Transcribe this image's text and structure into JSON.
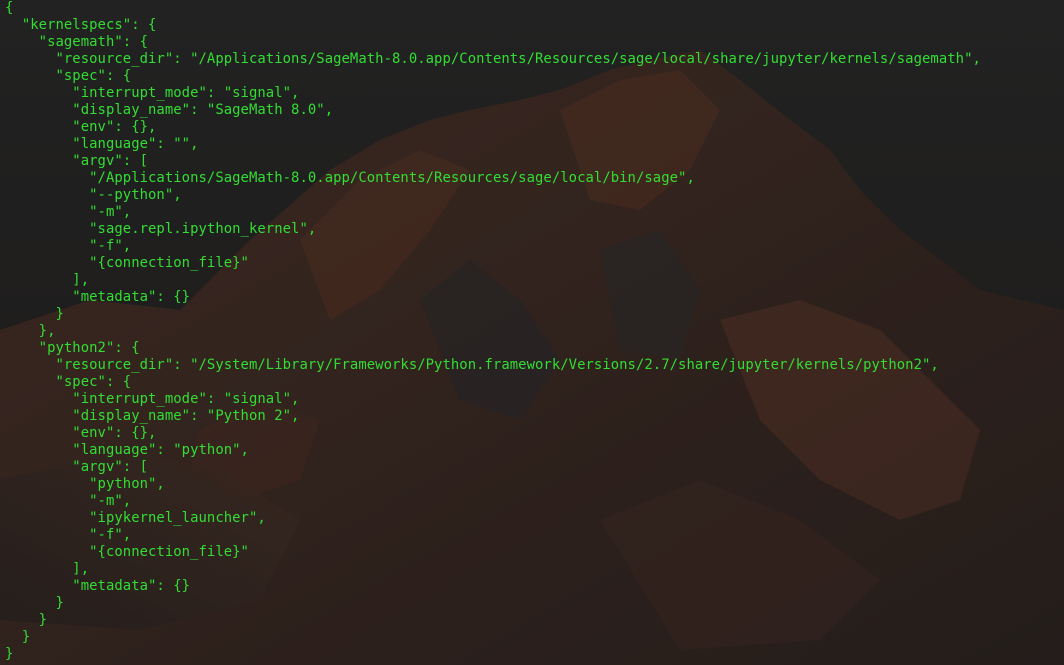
{
  "colors": {
    "text": "#33dd33",
    "background": "#252525"
  },
  "terminal": {
    "lines": [
      "{",
      "  \"kernelspecs\": {",
      "    \"sagemath\": {",
      "      \"resource_dir\": \"/Applications/SageMath-8.0.app/Contents/Resources/sage/local/share/jupyter/kernels/sagemath\",",
      "      \"spec\": {",
      "        \"interrupt_mode\": \"signal\",",
      "        \"display_name\": \"SageMath 8.0\",",
      "        \"env\": {},",
      "        \"language\": \"\",",
      "        \"argv\": [",
      "          \"/Applications/SageMath-8.0.app/Contents/Resources/sage/local/bin/sage\",",
      "          \"--python\",",
      "          \"-m\",",
      "          \"sage.repl.ipython_kernel\",",
      "          \"-f\",",
      "          \"{connection_file}\"",
      "        ],",
      "        \"metadata\": {}",
      "      }",
      "    },",
      "    \"python2\": {",
      "      \"resource_dir\": \"/System/Library/Frameworks/Python.framework/Versions/2.7/share/jupyter/kernels/python2\",",
      "      \"spec\": {",
      "        \"interrupt_mode\": \"signal\",",
      "        \"display_name\": \"Python 2\",",
      "        \"env\": {},",
      "        \"language\": \"python\",",
      "        \"argv\": [",
      "          \"python\",",
      "          \"-m\",",
      "          \"ipykernel_launcher\",",
      "          \"-f\",",
      "          \"{connection_file}\"",
      "        ],",
      "        \"metadata\": {}",
      "      }",
      "    }",
      "  }",
      "}"
    ]
  }
}
